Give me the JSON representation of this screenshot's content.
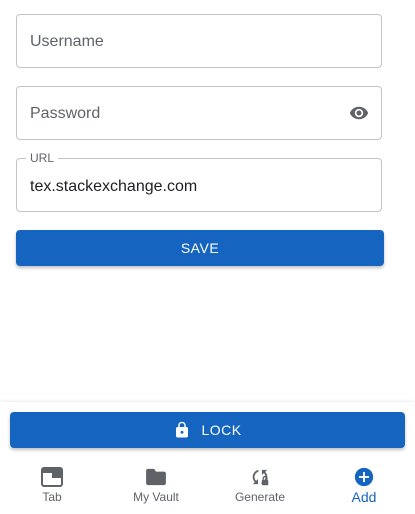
{
  "form": {
    "username": {
      "placeholder": "Username",
      "value": ""
    },
    "password": {
      "placeholder": "Password",
      "value": ""
    },
    "url": {
      "label": "URL",
      "value": "tex.stackexchange.com"
    },
    "save_label": "SAVE"
  },
  "lock_button": {
    "label": "LOCK"
  },
  "bottom_nav": {
    "items": [
      {
        "label": "Tab",
        "icon": "tab-icon",
        "active": false
      },
      {
        "label": "My Vault",
        "icon": "folder-icon",
        "active": false
      },
      {
        "label": "Generate",
        "icon": "generate-icon",
        "active": false
      },
      {
        "label": "Add",
        "icon": "add-icon",
        "active": true
      }
    ]
  },
  "colors": {
    "accent": "#1565c0",
    "icon": "#5f6368",
    "border": "#c4c4c4"
  }
}
